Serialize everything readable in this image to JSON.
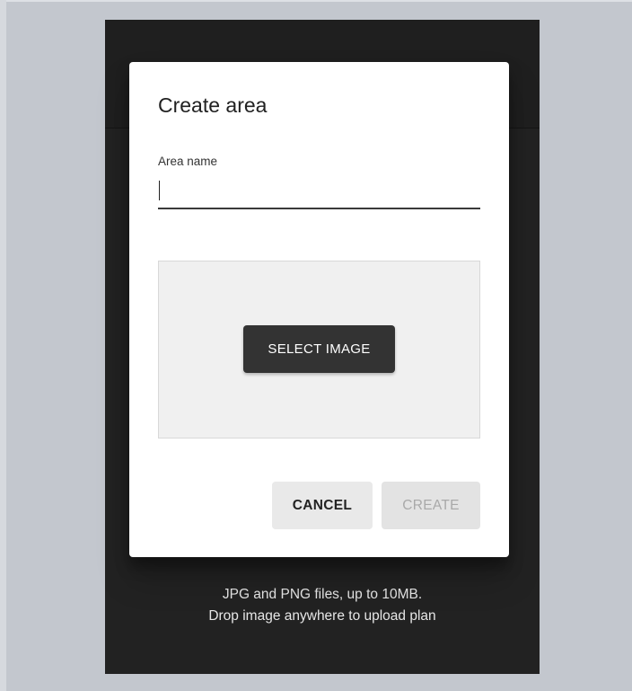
{
  "dialog": {
    "title": "Create area",
    "name_label": "Area name",
    "name_value": "",
    "select_image_label": "SELECT IMAGE",
    "cancel_label": "CANCEL",
    "create_label": "CREATE",
    "create_disabled": true
  },
  "background": {
    "hint_line1": "JPG and PNG files, up to 10MB.",
    "hint_line2": "Drop image anywhere to upload plan"
  },
  "colors": {
    "page_background": "#c3c7ce",
    "app_panel": "#222222",
    "dialog_surface": "#ffffff",
    "primary_button": "#333333",
    "disabled_text": "#a9a9a9"
  }
}
